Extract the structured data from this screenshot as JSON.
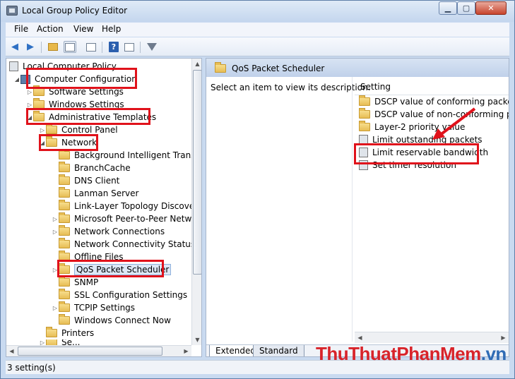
{
  "window": {
    "title": "Local Group Policy Editor",
    "min": "▁",
    "max": "▢",
    "close": "✕"
  },
  "menu": [
    "File",
    "Action",
    "View",
    "Help"
  ],
  "toolbar": {
    "icons": [
      "back-arrow-icon",
      "forward-arrow-icon",
      "up-folder-icon",
      "show-hide-tree-icon",
      "export-list-icon",
      "help-icon",
      "properties-icon",
      "filter-icon"
    ]
  },
  "tree": {
    "root": "Local Computer Policy",
    "computer_configuration": "Computer Configuration",
    "software_settings": "Software Settings",
    "windows_settings": "Windows Settings",
    "administrative_templates": "Administrative Templates",
    "control_panel": "Control Panel",
    "network": "Network",
    "network_children": [
      "Background Intelligent Transfe",
      "BranchCache",
      "DNS Client",
      "Lanman Server",
      "Link-Layer Topology Discover",
      "Microsoft Peer-to-Peer Netwo",
      "Network Connections",
      "Network Connectivity Status In",
      "Offline Files",
      "QoS Packet Scheduler",
      "SNMP",
      "SSL Configuration Settings",
      "TCPIP Settings",
      "Windows Connect Now"
    ],
    "printers": "Printers",
    "last_partial": "Se..."
  },
  "right": {
    "header": "QoS Packet Scheduler",
    "description": "Select an item to view its description.",
    "column_header": "Setting",
    "settings": [
      "DSCP value of conforming packets",
      "DSCP value of non-conforming pack",
      "Layer-2 priority value",
      "Limit outstanding packets",
      "Limit reservable bandwidth",
      "Set timer resolution"
    ],
    "tabs": [
      "Extended",
      "Standard"
    ]
  },
  "status": "3 setting(s)",
  "watermark": {
    "part1": "ThuThuat",
    "part2": "PhanMem",
    "part3": ".vn"
  },
  "colors": {
    "annotation_red": "#e0121b",
    "watermark_red": "#d8232a",
    "watermark_blue": "#2f6bb5"
  }
}
